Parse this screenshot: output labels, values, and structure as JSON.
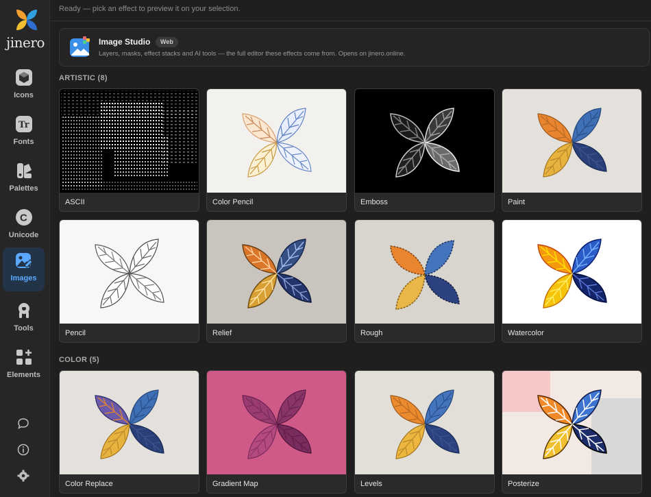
{
  "app": {
    "logo_text": "jinero"
  },
  "sidebar": {
    "items": [
      {
        "label": "Icons",
        "icon": "cube-icon"
      },
      {
        "label": "Fonts",
        "icon": "font-icon"
      },
      {
        "label": "Palettes",
        "icon": "palette-icon"
      },
      {
        "label": "Unicode",
        "icon": "unicode-icon"
      },
      {
        "label": "Images",
        "icon": "image-edit-icon",
        "active": true
      },
      {
        "label": "Tools",
        "icon": "tools-icon"
      },
      {
        "label": "Elements",
        "icon": "elements-icon"
      }
    ],
    "utilities": [
      "chat-icon",
      "info-icon",
      "settings-icon"
    ]
  },
  "status": {
    "text": "Ready — pick an effect to preview it on your selection."
  },
  "promo": {
    "title": "Image Studio",
    "badge": "Web",
    "description": "Layers, masks, effect stacks and AI tools — the full editor these effects come from. Opens on jinero.online."
  },
  "sections": [
    {
      "title": "ARTISTIC (8)",
      "effects": [
        "ASCII",
        "Color Pencil",
        "Emboss",
        "Paint",
        "Pencil",
        "Relief",
        "Rough",
        "Watercolor"
      ]
    },
    {
      "title": "COLOR (5)",
      "effects": [
        "Color Replace",
        "Gradient Map",
        "Levels",
        "Posterize"
      ]
    }
  ],
  "colors": {
    "accent": "#5aa9ff",
    "active_nav_bg": "#233448",
    "leaf_orange": "#e8852e",
    "leaf_blue": "#3f6fb4",
    "leaf_gold": "#e8b23f",
    "leaf_navy": "#2a3f78"
  }
}
